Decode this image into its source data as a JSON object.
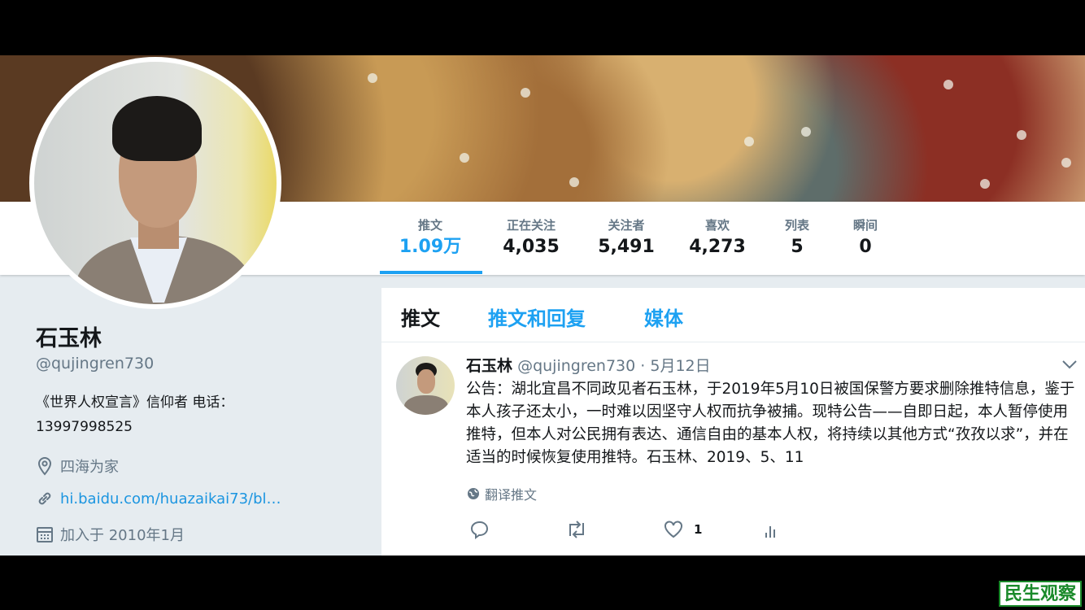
{
  "profile": {
    "name": "石玉林",
    "handle": "@qujingren730",
    "bio": "《世界人权宣言》信仰者 电话：13997998525",
    "location": "四海为家",
    "website": "hi.baidu.com/huazaikai73/bl…",
    "joined": "加入于 2010年1月"
  },
  "stats": [
    {
      "label": "推文",
      "value": "1.09万"
    },
    {
      "label": "正在关注",
      "value": "4,035"
    },
    {
      "label": "关注者",
      "value": "5,491"
    },
    {
      "label": "喜欢",
      "value": "4,273"
    },
    {
      "label": "列表",
      "value": "5"
    },
    {
      "label": "瞬间",
      "value": "0"
    }
  ],
  "tabs": {
    "tweets": "推文",
    "replies": "推文和回复",
    "media": "媒体"
  },
  "tweet": {
    "name": "石玉林",
    "handle": "@qujingren730",
    "separator": "·",
    "date": "5月12日",
    "text": "公告：湖北宜昌不同政见者石玉林，于2019年5月10日被国保警方要求删除推特信息，鉴于本人孩子还太小，一时难以因坚守人权而抗争被捕。现特公告——自即日起，本人暂停使用推特，但本人对公民拥有表达、通信自由的基本人权，将持续以其他方式“孜孜以求”，并在适当的时候恢复使用推特。石玉林、2019、5、11",
    "translate": "翻译推文",
    "like_count": "1"
  },
  "watermark": "民生观察",
  "colors": {
    "accent": "#1da1f2",
    "text": "#14171a",
    "muted": "#657786",
    "watermark": "#1a8a2a"
  }
}
